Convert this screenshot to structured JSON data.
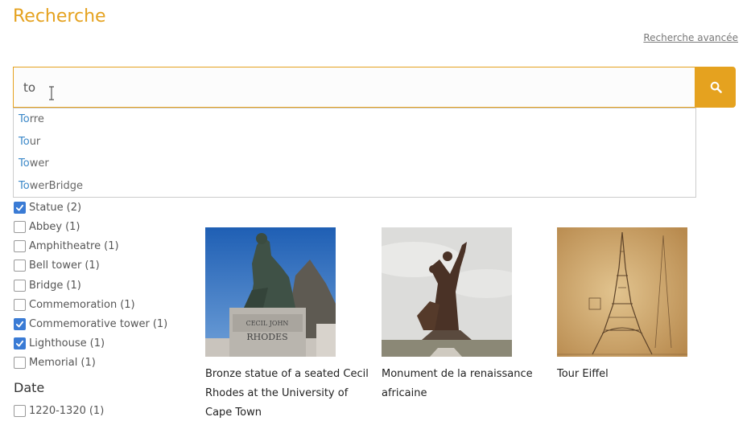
{
  "header": {
    "title": "Recherche",
    "advanced_link": "Recherche avancée"
  },
  "search": {
    "value": "to",
    "placeholder": ""
  },
  "autocomplete": [
    {
      "match": "To",
      "rest": "rre"
    },
    {
      "match": "To",
      "rest": "ur"
    },
    {
      "match": "To",
      "rest": "wer"
    },
    {
      "match": "To",
      "rest": "werBridge"
    }
  ],
  "facets": [
    {
      "label": "Statue",
      "count": "(2)",
      "checked": true
    },
    {
      "label": "Abbey",
      "count": "(1)",
      "checked": false
    },
    {
      "label": "Amphitheatre",
      "count": "(1)",
      "checked": false
    },
    {
      "label": "Bell tower",
      "count": "(1)",
      "checked": false
    },
    {
      "label": "Bridge",
      "count": "(1)",
      "checked": false
    },
    {
      "label": "Commemoration",
      "count": "(1)",
      "checked": false
    },
    {
      "label": "Commemorative tower",
      "count": "(1)",
      "checked": true
    },
    {
      "label": "Lighthouse",
      "count": "(1)",
      "checked": true
    },
    {
      "label": "Memorial",
      "count": "(1)",
      "checked": false
    }
  ],
  "date_section": {
    "heading": "Date",
    "items": [
      {
        "label": "1220-1320",
        "count": "(1)",
        "checked": false
      }
    ]
  },
  "results": [
    {
      "caption": "Bronze statue of a seated Cecil Rhodes at the University of Cape Town"
    },
    {
      "caption": "Monument de la renaissance africaine"
    },
    {
      "caption": "Tour Eiffel"
    }
  ],
  "colors": {
    "accent": "#e5a21f",
    "link": "#3a87c8",
    "checkbox": "#3a7bd5"
  },
  "icons": {
    "search_button": "search-icon",
    "checkbox": "check-icon"
  }
}
